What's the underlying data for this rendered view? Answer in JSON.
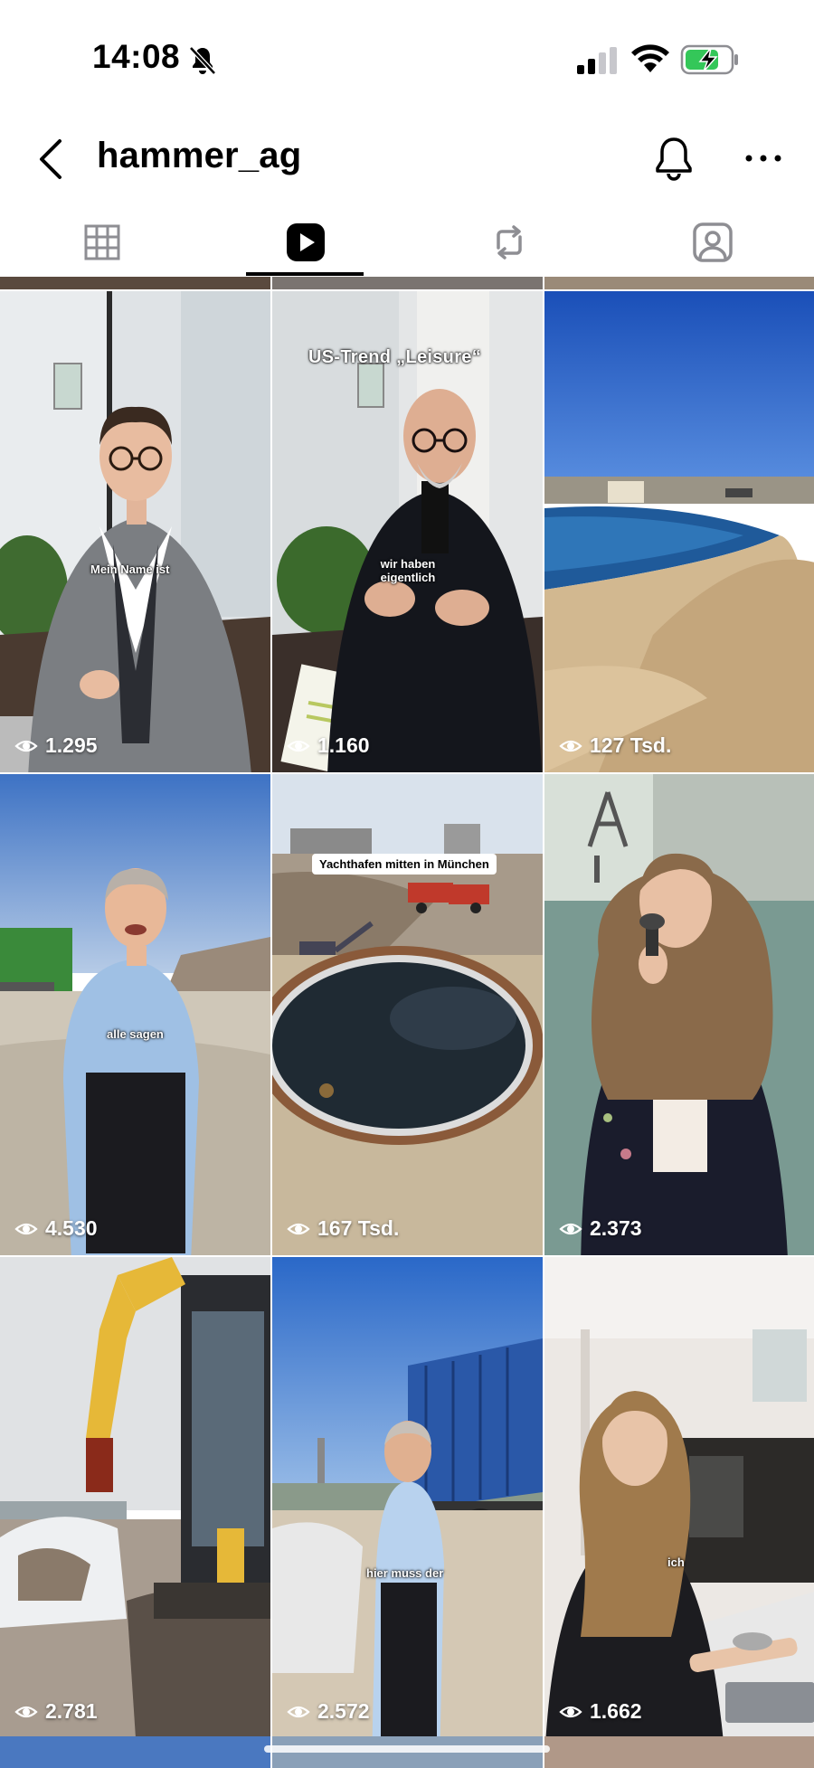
{
  "status_bar": {
    "time": "14:08",
    "icons": [
      "bell-slash-icon",
      "signal-icon",
      "wifi-icon",
      "battery-charging-icon"
    ],
    "battery_color": "#34c759"
  },
  "header": {
    "username": "hammer_ag",
    "icons": [
      "chevron-left-icon",
      "bell-icon",
      "more-icon"
    ]
  },
  "tabs": [
    {
      "icon": "grid-icon",
      "active": false
    },
    {
      "icon": "reels-icon",
      "active": true
    },
    {
      "icon": "reposts-icon",
      "active": false
    },
    {
      "icon": "tagged-icon",
      "active": false
    }
  ],
  "reels": [
    {
      "views": "1.295",
      "caption": "Mein Name ist"
    },
    {
      "views": "1.160",
      "caption": "wir haben eigentlich",
      "title": "US-Trend „Leisure“"
    },
    {
      "views": "127 Tsd.",
      "caption": ""
    },
    {
      "views": "4.530",
      "caption": "alle sagen"
    },
    {
      "views": "167 Tsd.",
      "caption": "Yachthafen mitten in München"
    },
    {
      "views": "2.373",
      "caption": ""
    },
    {
      "views": "2.781",
      "caption": ""
    },
    {
      "views": "2.572",
      "caption": "hier muss der"
    },
    {
      "views": "1.662",
      "caption": "ich"
    }
  ]
}
